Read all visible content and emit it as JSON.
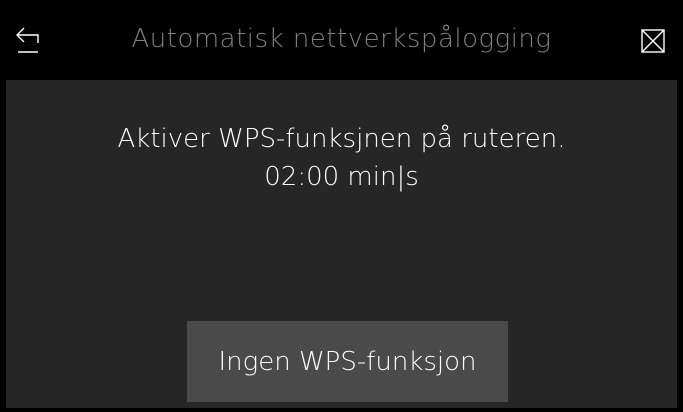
{
  "header": {
    "title": "Automatisk nettverkspålogging",
    "back_icon": "back-arrow-icon",
    "close_icon": "close-icon"
  },
  "message": {
    "instruction": "Aktiver WPS-funksjnen på ruteren.",
    "timer": "02:00 min|s"
  },
  "actions": {
    "no_wps_label": "Ingen WPS-funksjon"
  },
  "colors": {
    "background": "#000000",
    "panel": "#262626",
    "button": "#4a4a4a",
    "title_text": "#808080",
    "text": "#ffffff"
  }
}
